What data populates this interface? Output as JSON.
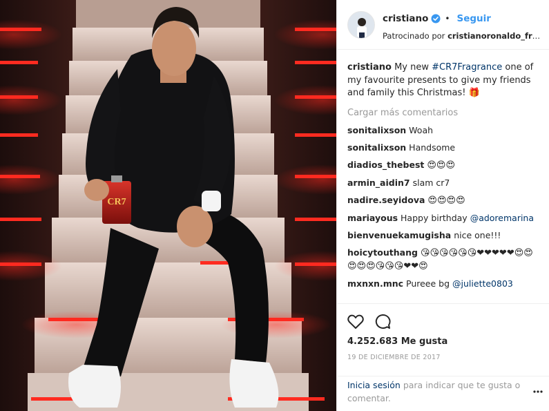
{
  "header": {
    "username": "cristiano",
    "dot": "•",
    "follow_label": "Seguir",
    "sponsored_prefix": "Patrocinado por",
    "sponsor": "cristianoronaldo_fragrances"
  },
  "caption": {
    "user": "cristiano",
    "text_before": "My new",
    "hashtag": "#CR7Fragrance",
    "text_after": "one of my favourite presents to give my friends and family this Christmas!",
    "emoji": "🎁"
  },
  "load_more_label": "Cargar más comentarios",
  "comments": [
    {
      "user": "sonitalixson",
      "text": "Woah"
    },
    {
      "user": "sonitalixson",
      "text": "Handsome"
    },
    {
      "user": "diadios_thebest",
      "text": "😍😍😍"
    },
    {
      "user": "armin_aidin7",
      "text": "slam cr7"
    },
    {
      "user": "nadire.seyidova",
      "text": "😍😍😍😍"
    },
    {
      "user": "mariayous",
      "text": "Happy birthday",
      "mention": "@adoremarina"
    },
    {
      "user": "bienvenuekamugisha",
      "text": "nice one!!!"
    },
    {
      "user": "hoicytouthang",
      "text": "😘😘😘😘😘😘❤❤❤❤❤😍😍😍😍😍😘😘😘❤❤😍"
    },
    {
      "user": "mxnxn.mnc",
      "text": "Pureee bg",
      "mention": "@juliette0803"
    }
  ],
  "likes": "4.252.683 Me gusta",
  "date": "19 DE DICIEMBRE DE 2017",
  "login": {
    "link": "Inicia sesión",
    "text": "para indicar que te gusta o comentar."
  },
  "icons": {
    "verified": "verified-badge-icon",
    "like": "heart-outline-icon",
    "comment": "comment-bubble-icon",
    "more": "more-options-icon"
  },
  "colors": {
    "link_blue": "#3897f0",
    "mention_navy": "#003569",
    "muted_gray": "#999999",
    "text": "#262626",
    "border": "#efefef"
  },
  "photo": {
    "bottle_brand": "CR7"
  }
}
